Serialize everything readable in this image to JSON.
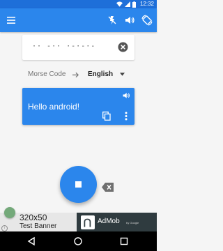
{
  "status_bar": {
    "time": "12:32",
    "icons": [
      "wifi-icon",
      "signal-icon",
      "battery-icon"
    ],
    "background": "#1e6fd9"
  },
  "app_bar": {
    "background": "#2b86ec",
    "nav_icon": "menu-icon",
    "action_icons": [
      "flash-off-icon",
      "volume-icon",
      "screen-rotation-icon"
    ]
  },
  "input": {
    "morse_text": "·· -·· ·-·-·-"
  },
  "languages": {
    "source": "Morse Code",
    "target": "English"
  },
  "output": {
    "text": "Hello android!",
    "background": "#2b86ec"
  },
  "ad": {
    "size_label": "320x50",
    "title": "Test Banner",
    "brand": "AdMob",
    "brand_sub": "by Google",
    "choices_glyph": "i"
  },
  "navbar": {
    "icons": [
      "back-icon",
      "home-icon",
      "recents-icon"
    ]
  }
}
